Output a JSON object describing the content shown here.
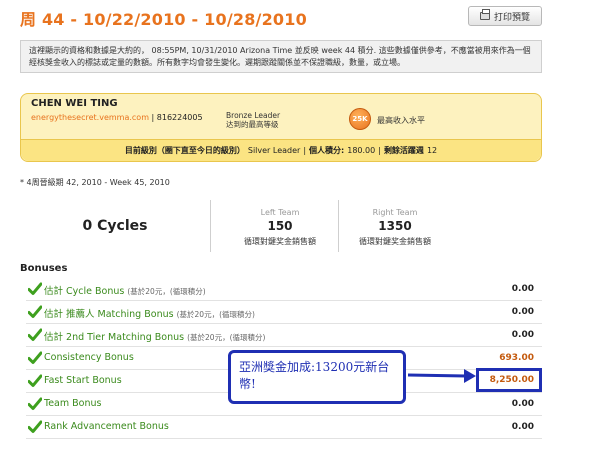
{
  "header": {
    "title": "周 44 - 10/22/2010 - 10/28/2010",
    "print_label": "打印預覽"
  },
  "notice": {
    "text": "這裡顯示的資格和數據是大約的， 08:55PM, 10/31/2010 Arizona Time 並反映 week 44 積分. 這些數據僅供參考，不應當被用來作為一個經核獎金收入的標誌或定量的數額。所有數字均會發生變化。遲期跟蹤關係並不保證職級，數量，或立場。"
  },
  "member": {
    "name": "CHEN WEI TING",
    "site": "energythesecret.vemma.com",
    "id": "| 816224005",
    "rank_title": "Bronze Leader",
    "rank_sub": "达到的最高等级",
    "badge": "25K",
    "max_level": "最高收入水平",
    "current_level_label": "目前級別（圈下直至今日的級別）",
    "current_level_value": "Silver Leader",
    "personal_points_label": "個人積分:",
    "personal_points_value": "180.00",
    "weeks_left_label": "剩餘活躍週",
    "weeks_left_value": "12"
  },
  "four_week": "* 4周晉級期 42, 2010 - Week 45, 2010",
  "stats": {
    "cycles": "0 Cycles",
    "left_label": "Left Team",
    "left_value": "150",
    "left_sub": "循環對鍵奖金銷售額",
    "right_label": "Right Team",
    "right_value": "1350",
    "right_sub": "循環對鍵奖金銷售額"
  },
  "bonuses": {
    "heading": "Bonuses",
    "rows": [
      {
        "label": "估計 Cycle Bonus",
        "note": "(基於20元，(循環積分)",
        "value": "0.00"
      },
      {
        "label": "估計 推薦人 Matching Bonus",
        "note": "(基於20元，(循環積分)",
        "value": "0.00"
      },
      {
        "label": "估計 2nd Tier Matching Bonus",
        "note": "(基於20元，(循環積分)",
        "value": "0.00"
      },
      {
        "label": "Consistency Bonus",
        "note": "",
        "value": "693.00"
      },
      {
        "label": "Fast Start Bonus",
        "note": "",
        "value": "8,250.00"
      },
      {
        "label": "Team Bonus",
        "note": "",
        "value": "0.00"
      },
      {
        "label": "Rank Advancement Bonus",
        "note": "",
        "value": "0.00"
      }
    ]
  },
  "annotation": {
    "text": "亞洲獎金加成:13200元新台幣!"
  },
  "colors": {
    "accent": "#e8731e",
    "bonus_green": "#3a8a1c",
    "annotation_blue": "#1f2fb3",
    "member_bg": "#fdf2bf"
  }
}
